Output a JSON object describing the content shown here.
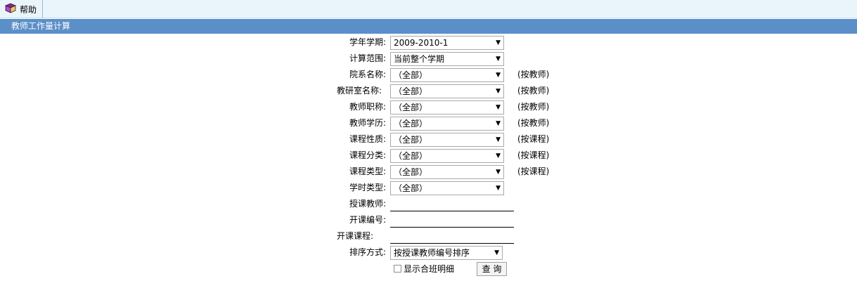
{
  "toolbar": {
    "help_label": "帮助",
    "help_icon": "book-icon"
  },
  "title": "教师工作量计算",
  "fields": {
    "semester": {
      "label": "学年学期:",
      "value": "2009-2010-1"
    },
    "scope": {
      "label": "计算范围:",
      "value": "当前整个学期"
    },
    "department": {
      "label": "院系名称:",
      "value": "（全部）",
      "hint": "(按教师)"
    },
    "office": {
      "label": "教研室名称:",
      "value": "（全部）",
      "hint": "(按教师)"
    },
    "title_rank": {
      "label": "教师职称:",
      "value": "（全部）",
      "hint": "(按教师)"
    },
    "education": {
      "label": "教师学历:",
      "value": "（全部）",
      "hint": "(按教师)"
    },
    "course_nature": {
      "label": "课程性质:",
      "value": "（全部）",
      "hint": "(按课程)"
    },
    "course_category": {
      "label": "课程分类:",
      "value": "（全部）",
      "hint": "(按课程)"
    },
    "course_type": {
      "label": "课程类型:",
      "value": "（全部）",
      "hint": "(按课程)"
    },
    "hour_type": {
      "label": "学时类型:",
      "value": "（全部）"
    },
    "teacher": {
      "label": "授课教师:",
      "value": ""
    },
    "course_no": {
      "label": "开课编号:",
      "value": ""
    },
    "course": {
      "label": "开课课程:",
      "value": ""
    },
    "sort": {
      "label": "排序方式:",
      "value": "按授课教师编号排序"
    }
  },
  "show_detail_label": "显示合班明细",
  "query_label": "查 询",
  "colors": {
    "titlebar": "#5b8fc7",
    "toolbar": "#eaf5fb"
  }
}
